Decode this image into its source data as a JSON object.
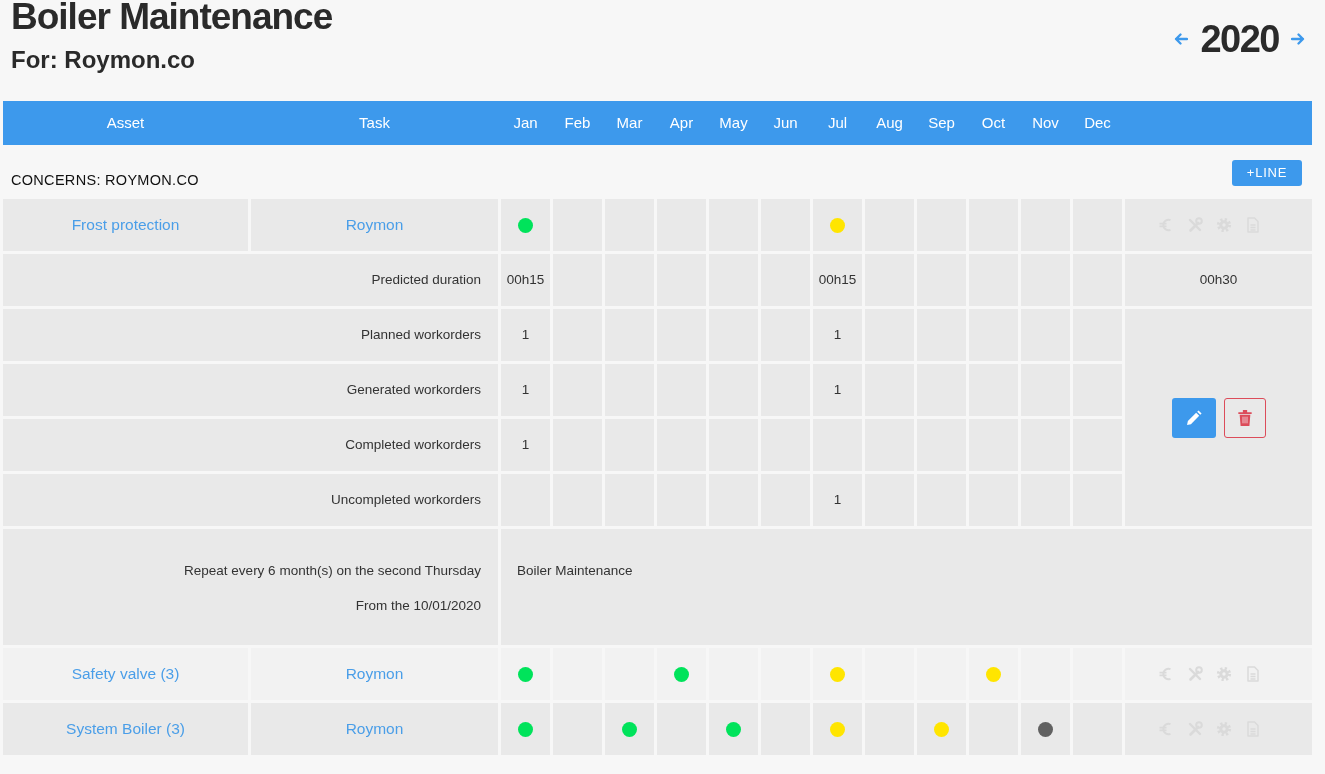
{
  "header": {
    "title": "Boiler Maintenance",
    "subtitle": "For: Roymon.co",
    "year": "2020"
  },
  "columns": [
    "Asset",
    "Task",
    "Jan",
    "Feb",
    "Mar",
    "Apr",
    "May",
    "Jun",
    "Jul",
    "Aug",
    "Sep",
    "Oct",
    "Nov",
    "Dec"
  ],
  "group": {
    "label": "CONCERNS: ROYMON.CO",
    "add_button": "+LINE"
  },
  "rows": [
    {
      "asset": "Frost protection",
      "task": "Roymon",
      "months": [
        {
          "kind": "dot",
          "color": "#00e35b"
        },
        {
          "kind": "blank"
        },
        {
          "kind": "blank"
        },
        {
          "kind": "blank"
        },
        {
          "kind": "blank"
        },
        {
          "kind": "blank"
        },
        {
          "kind": "dot",
          "color": "#ffe500"
        },
        {
          "kind": "blank"
        },
        {
          "kind": "blank"
        },
        {
          "kind": "blank"
        },
        {
          "kind": "blank"
        },
        {
          "kind": "blank"
        }
      ],
      "details": {
        "metrics": [
          {
            "label": "Predicted duration",
            "values": [
              {
                "kind": "text",
                "text": "00h15"
              },
              {
                "kind": "blank"
              },
              {
                "kind": "blank"
              },
              {
                "kind": "blank"
              },
              {
                "kind": "blank"
              },
              {
                "kind": "blank"
              },
              {
                "kind": "text",
                "text": "00h15"
              },
              {
                "kind": "blank"
              },
              {
                "kind": "blank"
              },
              {
                "kind": "blank"
              },
              {
                "kind": "blank"
              },
              {
                "kind": "blank"
              }
            ],
            "total": "00h30"
          },
          {
            "label": "Planned workorders",
            "values": [
              {
                "kind": "text",
                "text": "1"
              },
              {
                "kind": "blank"
              },
              {
                "kind": "blank"
              },
              {
                "kind": "blank"
              },
              {
                "kind": "blank"
              },
              {
                "kind": "blank"
              },
              {
                "kind": "text",
                "text": "1"
              },
              {
                "kind": "blank"
              },
              {
                "kind": "blank"
              },
              {
                "kind": "blank"
              },
              {
                "kind": "blank"
              },
              {
                "kind": "blank"
              }
            ]
          },
          {
            "label": "Generated workorders",
            "values": [
              {
                "kind": "text",
                "text": "1"
              },
              {
                "kind": "blank"
              },
              {
                "kind": "blank"
              },
              {
                "kind": "blank"
              },
              {
                "kind": "blank"
              },
              {
                "kind": "blank"
              },
              {
                "kind": "text",
                "text": "1"
              },
              {
                "kind": "blank"
              },
              {
                "kind": "blank"
              },
              {
                "kind": "blank"
              },
              {
                "kind": "blank"
              },
              {
                "kind": "blank"
              }
            ]
          },
          {
            "label": "Completed workorders",
            "values": [
              {
                "kind": "text",
                "text": "1"
              },
              {
                "kind": "blank"
              },
              {
                "kind": "blank"
              },
              {
                "kind": "blank"
              },
              {
                "kind": "blank"
              },
              {
                "kind": "blank"
              },
              {
                "kind": "blank"
              },
              {
                "kind": "blank"
              },
              {
                "kind": "blank"
              },
              {
                "kind": "blank"
              },
              {
                "kind": "blank"
              },
              {
                "kind": "blank"
              }
            ]
          },
          {
            "label": "Uncompleted workorders",
            "values": [
              {
                "kind": "blank"
              },
              {
                "kind": "blank"
              },
              {
                "kind": "blank"
              },
              {
                "kind": "blank"
              },
              {
                "kind": "blank"
              },
              {
                "kind": "blank"
              },
              {
                "kind": "text",
                "text": "1"
              },
              {
                "kind": "blank"
              },
              {
                "kind": "blank"
              },
              {
                "kind": "blank"
              },
              {
                "kind": "blank"
              },
              {
                "kind": "blank"
              }
            ]
          }
        ],
        "schedule": [
          "Repeat every 6 month(s) on the second Thursday",
          "From the 10/01/2020"
        ],
        "task_name": "Boiler Maintenance"
      }
    },
    {
      "asset": "Safety valve (3)",
      "task": "Roymon",
      "months": [
        {
          "kind": "dot",
          "color": "#00e35b"
        },
        {
          "kind": "blank"
        },
        {
          "kind": "blank"
        },
        {
          "kind": "dot",
          "color": "#00e35b"
        },
        {
          "kind": "blank"
        },
        {
          "kind": "blank"
        },
        {
          "kind": "dot",
          "color": "#ffe500"
        },
        {
          "kind": "blank"
        },
        {
          "kind": "blank"
        },
        {
          "kind": "dot",
          "color": "#ffe500"
        },
        {
          "kind": "blank"
        },
        {
          "kind": "blank"
        }
      ]
    },
    {
      "asset": "System Boiler (3)",
      "task": "Roymon",
      "months": [
        {
          "kind": "dot",
          "color": "#00e35b"
        },
        {
          "kind": "blank"
        },
        {
          "kind": "dot",
          "color": "#00e35b"
        },
        {
          "kind": "blank"
        },
        {
          "kind": "dot",
          "color": "#00e35b"
        },
        {
          "kind": "blank"
        },
        {
          "kind": "dot",
          "color": "#ffe500"
        },
        {
          "kind": "blank"
        },
        {
          "kind": "dot",
          "color": "#ffe500"
        },
        {
          "kind": "blank"
        },
        {
          "kind": "dot",
          "color": "#616161"
        },
        {
          "kind": "blank"
        }
      ]
    }
  ]
}
